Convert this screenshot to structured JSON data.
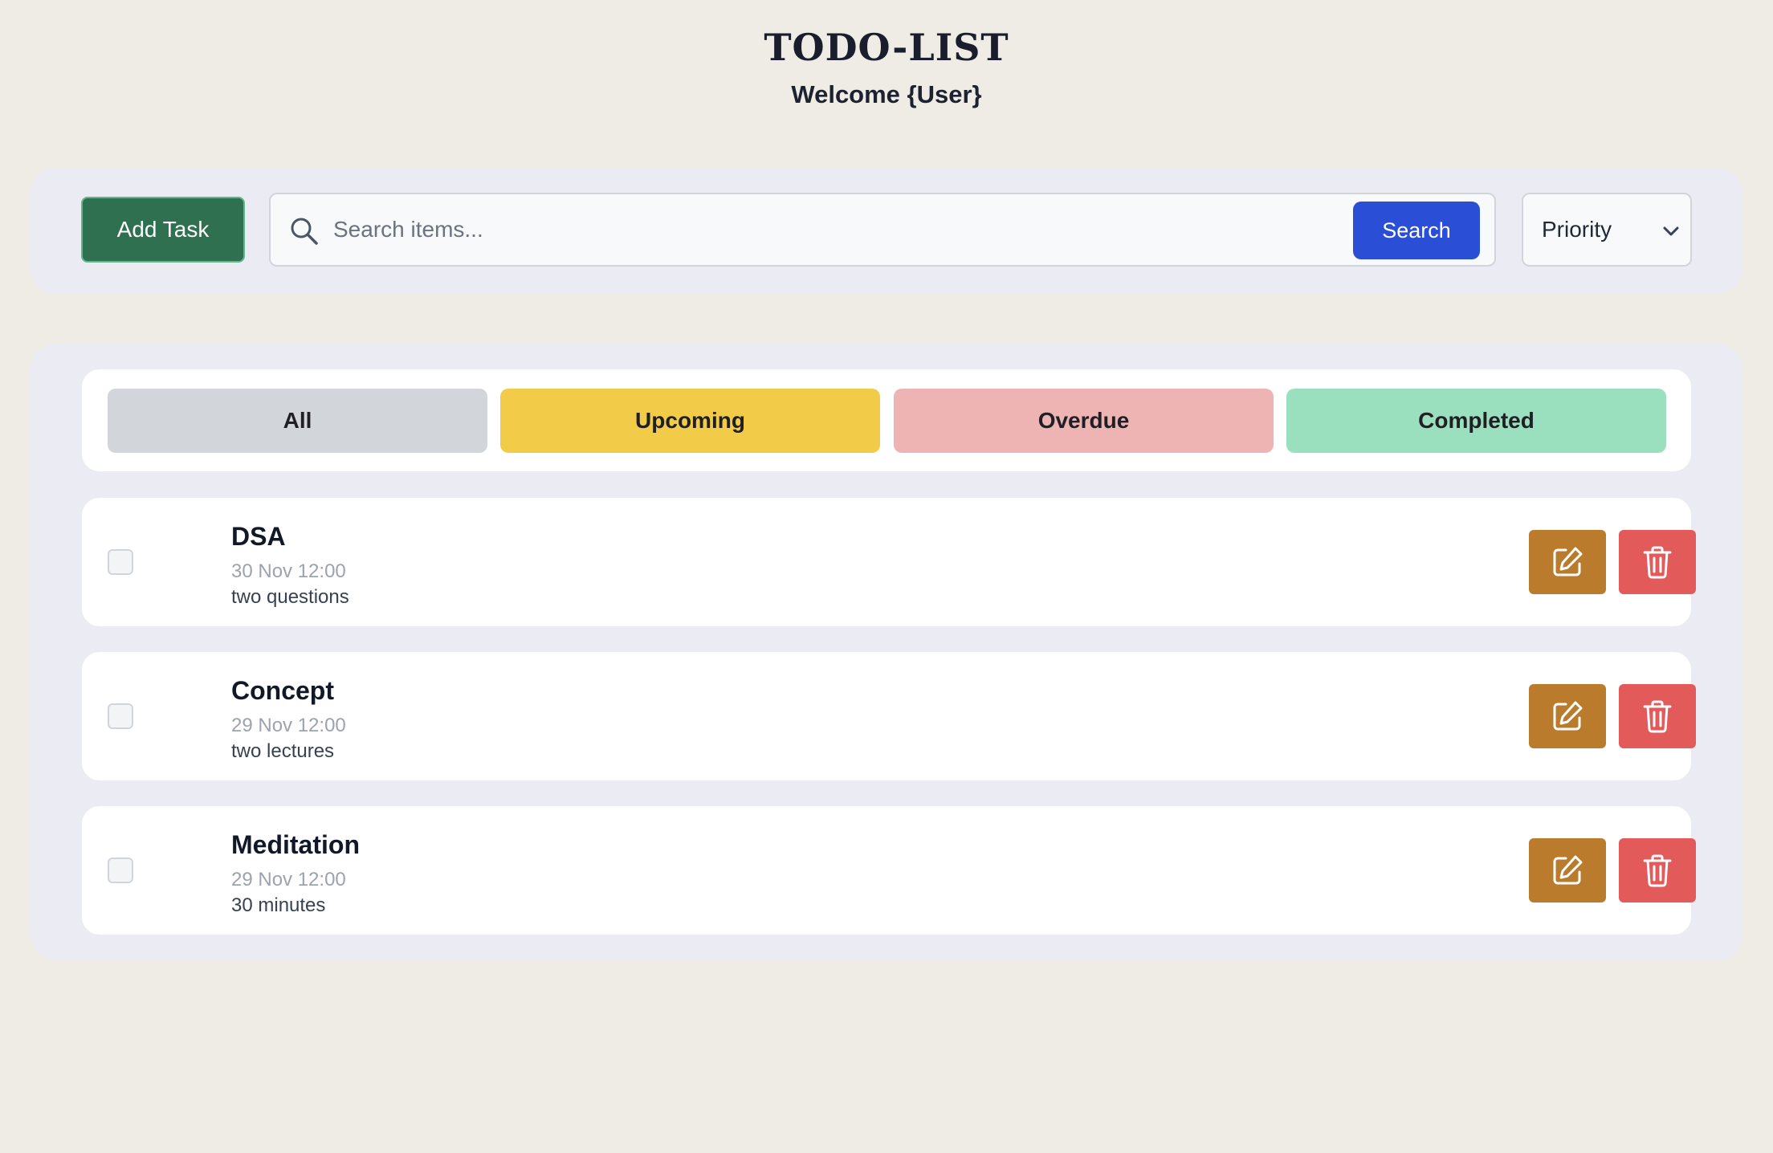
{
  "header": {
    "title": "TODO-LIST",
    "welcome": "Welcome {User}"
  },
  "toolbar": {
    "add_label": "Add Task",
    "search_placeholder": "Search items...",
    "search_label": "Search",
    "priority_label": "Priority"
  },
  "filters": [
    {
      "label": "All",
      "color": "#d2d5da"
    },
    {
      "label": "Upcoming",
      "color": "#f2cb48"
    },
    {
      "label": "Overdue",
      "color": "#edb4b3"
    },
    {
      "label": "Completed",
      "color": "#9be0be"
    }
  ],
  "tasks": [
    {
      "title": "DSA",
      "date": "30 Nov 12:00",
      "description": "two questions",
      "completed": false
    },
    {
      "title": "Concept",
      "date": "29 Nov 12:00",
      "description": "two lectures",
      "completed": false
    },
    {
      "title": "Meditation",
      "date": "29 Nov 12:00",
      "description": "30 minutes",
      "completed": false
    }
  ],
  "icons": {
    "search": "search-icon",
    "dropdown": "chevron-down-icon",
    "edit": "edit-icon",
    "delete": "trash-icon"
  },
  "colors": {
    "add_button": "#2e7050",
    "search_button": "#2a4fd6",
    "edit_button": "#ba7c2c",
    "delete_button": "#e25a5a"
  }
}
